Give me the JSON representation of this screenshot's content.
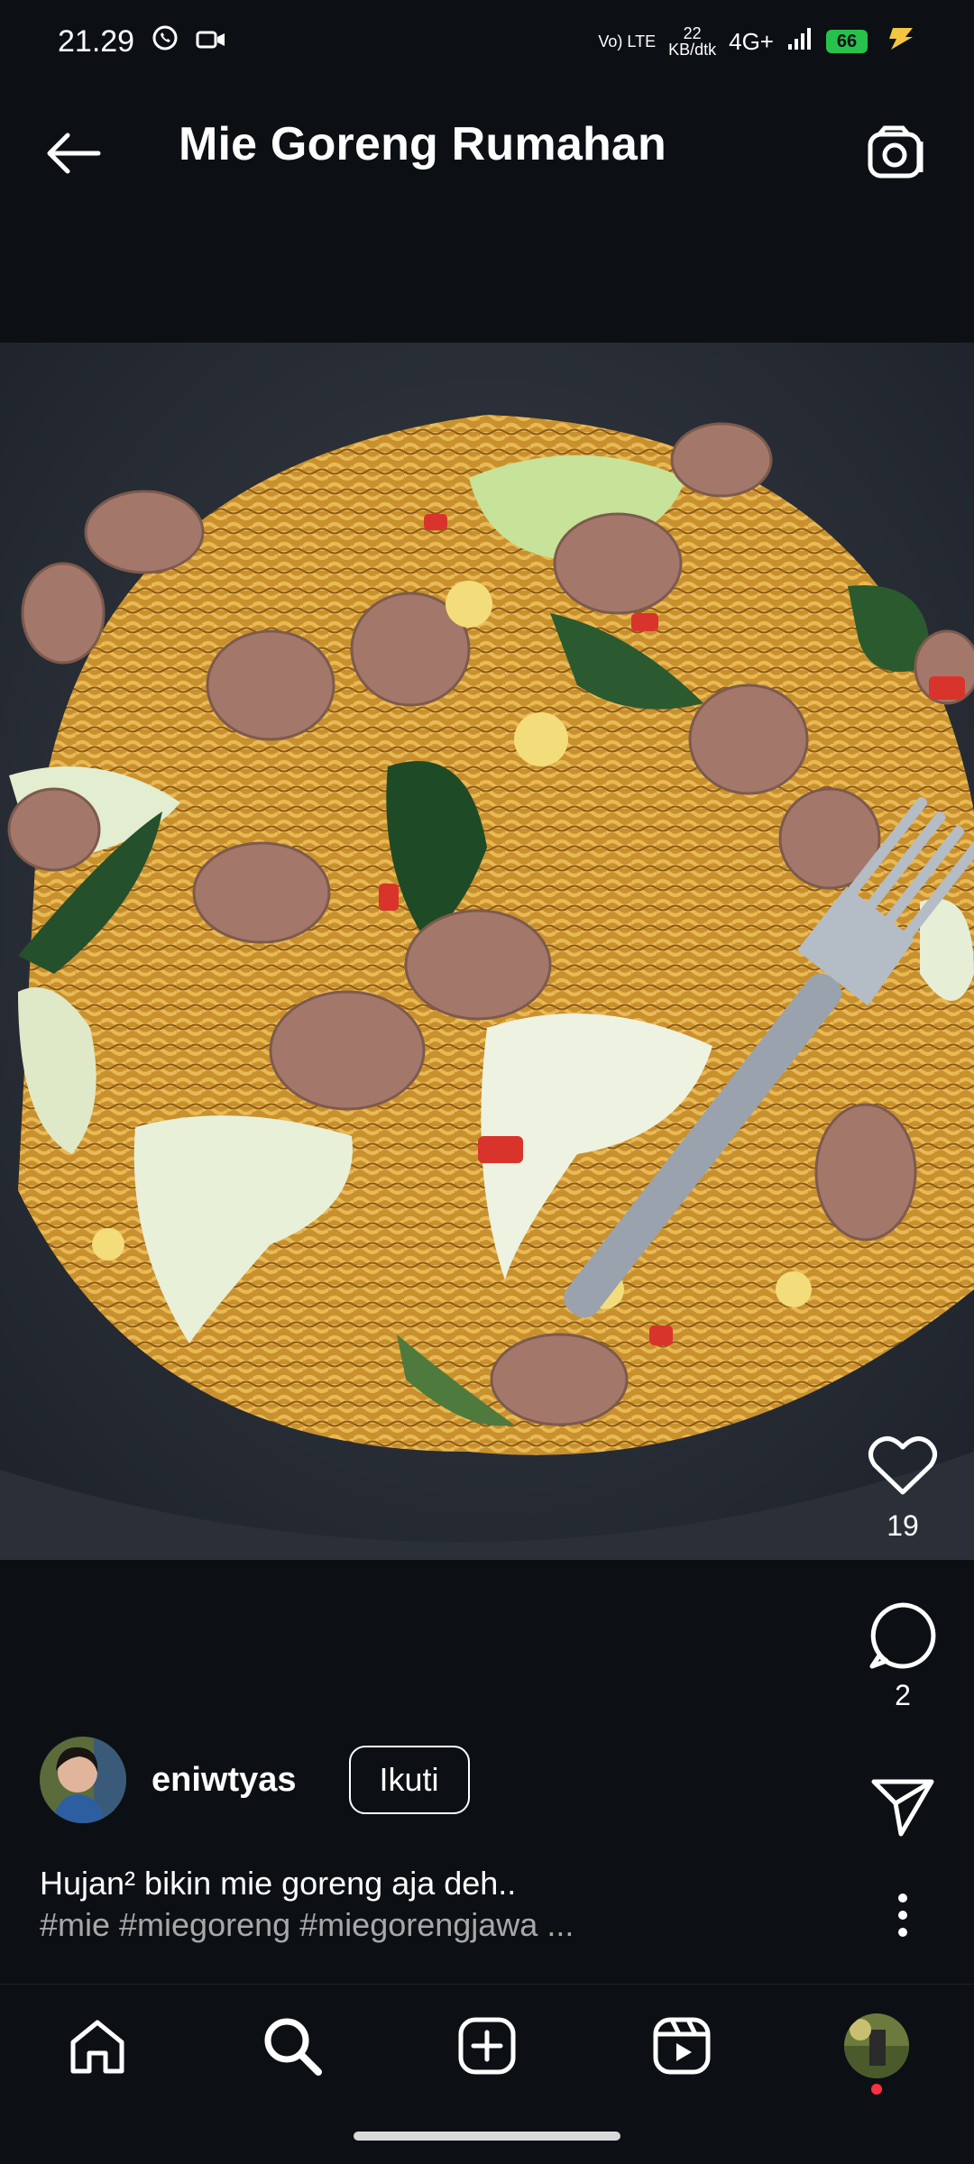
{
  "status_bar": {
    "time": "21.29",
    "net_type": "Vo) LTE",
    "speed_value": "22",
    "speed_unit": "KB/dtk",
    "network": "4G+",
    "battery": "66",
    "icons": [
      "whatsapp-icon",
      "video-call-icon",
      "signal-icon",
      "battery-icon",
      "charging-icon"
    ]
  },
  "header": {
    "title": "Mie Goreng Rumahan",
    "back_icon": "arrow-left-icon",
    "camera_icon": "camera-icon"
  },
  "post": {
    "media_description_icon": "photo",
    "likes": "19",
    "comments": "2",
    "author": "eniwtyas",
    "follow_label": "Ikuti",
    "caption_line1": "Hujan² bikin mie goreng aja deh..",
    "caption_tags": "#mie #miegoreng #miegorengjawa ..."
  },
  "nav": {
    "items": [
      "home-icon",
      "search-icon",
      "create-icon",
      "reels-icon",
      "profile-avatar"
    ]
  }
}
